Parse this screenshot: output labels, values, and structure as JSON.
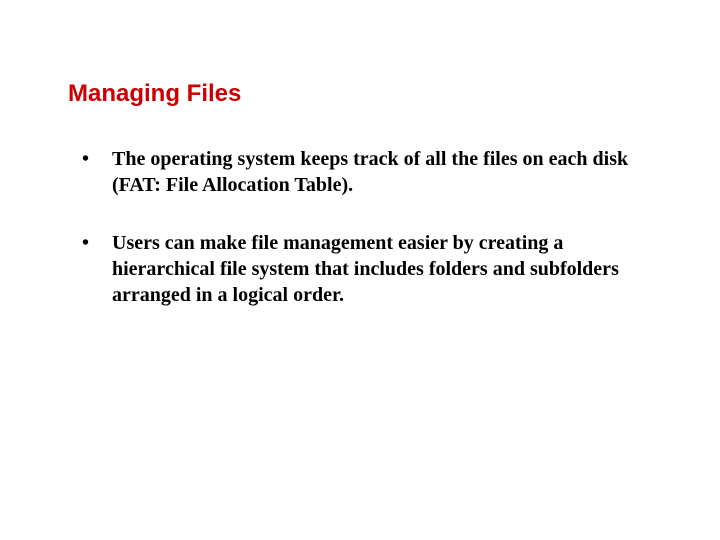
{
  "slide": {
    "title": "Managing Files",
    "bullets": [
      "The operating system keeps track of all the files on each disk (FAT: File Allocation Table).",
      "Users can make file management easier by creating a hierarchical file system that includes folders and subfolders arranged in a logical order."
    ]
  }
}
